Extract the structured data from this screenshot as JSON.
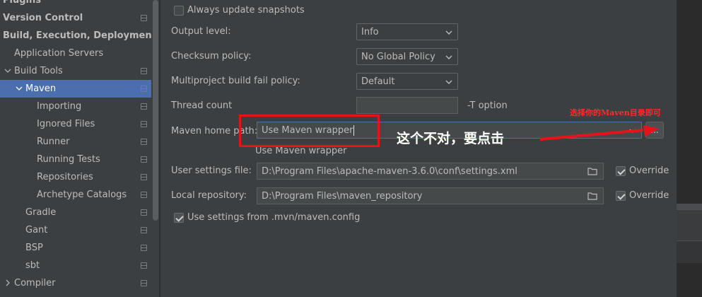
{
  "sidebar": {
    "items": [
      {
        "label": "Plugins",
        "level": 0,
        "bold": true,
        "arrow": "none",
        "cfg": false,
        "selected": false
      },
      {
        "label": "Version Control",
        "level": 0,
        "bold": true,
        "arrow": "none",
        "cfg": true,
        "selected": false
      },
      {
        "label": "Build, Execution, Deployment",
        "level": 0,
        "bold": true,
        "arrow": "none",
        "cfg": false,
        "selected": false
      },
      {
        "label": "Application Servers",
        "level": 1,
        "bold": false,
        "arrow": "none",
        "cfg": false,
        "selected": false
      },
      {
        "label": "Build Tools",
        "level": 1,
        "bold": false,
        "arrow": "down",
        "cfg": true,
        "selected": false
      },
      {
        "label": "Maven",
        "level": 2,
        "bold": false,
        "arrow": "down",
        "cfg": true,
        "selected": true
      },
      {
        "label": "Importing",
        "level": 3,
        "bold": false,
        "arrow": "none",
        "cfg": true,
        "selected": false
      },
      {
        "label": "Ignored Files",
        "level": 3,
        "bold": false,
        "arrow": "none",
        "cfg": true,
        "selected": false
      },
      {
        "label": "Runner",
        "level": 3,
        "bold": false,
        "arrow": "none",
        "cfg": true,
        "selected": false
      },
      {
        "label": "Running Tests",
        "level": 3,
        "bold": false,
        "arrow": "none",
        "cfg": true,
        "selected": false
      },
      {
        "label": "Repositories",
        "level": 3,
        "bold": false,
        "arrow": "none",
        "cfg": true,
        "selected": false
      },
      {
        "label": "Archetype Catalogs",
        "level": 3,
        "bold": false,
        "arrow": "none",
        "cfg": true,
        "selected": false
      },
      {
        "label": "Gradle",
        "level": 2,
        "bold": false,
        "arrow": "none",
        "cfg": true,
        "selected": false
      },
      {
        "label": "Gant",
        "level": 2,
        "bold": false,
        "arrow": "none",
        "cfg": true,
        "selected": false
      },
      {
        "label": "BSP",
        "level": 2,
        "bold": false,
        "arrow": "none",
        "cfg": true,
        "selected": false
      },
      {
        "label": "sbt",
        "level": 2,
        "bold": false,
        "arrow": "none",
        "cfg": true,
        "selected": false
      },
      {
        "label": "Compiler",
        "level": 1,
        "bold": false,
        "arrow": "right",
        "cfg": true,
        "selected": false
      }
    ]
  },
  "settings": {
    "always_update_label": "Always update snapshots",
    "always_update_checked": false,
    "output_level_label": "Output level:",
    "output_level_value": "Info",
    "checksum_label": "Checksum policy:",
    "checksum_value": "No Global Policy",
    "multiproject_label": "Multiproject build fail policy:",
    "multiproject_value": "Default",
    "thread_count_label": "Thread count",
    "thread_count_value": "",
    "thread_option_hint": "-T option",
    "maven_home_label": "Maven home path:",
    "maven_home_value": "Use Maven wrapper",
    "maven_home_hint": "Use Maven wrapper",
    "browse_label": "...",
    "user_settings_label": "User settings file:",
    "user_settings_value": "D:\\Program Files\\apache-maven-3.6.0\\conf\\settings.xml",
    "user_settings_override_label": "Override",
    "user_settings_override_checked": true,
    "local_repo_label": "Local repository:",
    "local_repo_value": "D:\\Program Files\\maven_repository",
    "local_repo_override_label": "Override",
    "local_repo_override_checked": true,
    "mvn_config_label": "Use settings from .mvn/maven.config",
    "mvn_config_checked": true
  },
  "annotations": {
    "small_note": "选择你的Maven目录即可",
    "big_note": "这个不对，要点击",
    "color": "#e8131a"
  },
  "colors": {
    "selection": "#4b6eaf",
    "panel": "#3c3f41"
  }
}
